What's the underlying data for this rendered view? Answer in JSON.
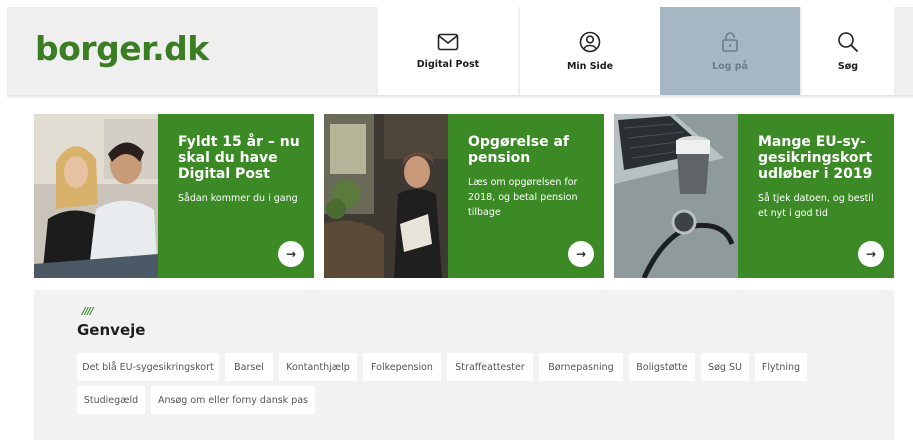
{
  "header": {
    "logo": "borger.dk",
    "nav": [
      {
        "label": "Digital Post",
        "icon": "envelope-icon"
      },
      {
        "label": "Min Side",
        "icon": "user-icon"
      },
      {
        "label": "Log på",
        "icon": "lock-icon"
      },
      {
        "label": "Søg",
        "icon": "search-icon"
      }
    ]
  },
  "cards": [
    {
      "title": "Fyldt 15 år – nu skal du have Digital Post",
      "text": "Sådan kommer du i gang",
      "arrow": "→",
      "image": "two teenagers talking"
    },
    {
      "title": "Opgørelse af pension",
      "text": "Læs om opgørelsen for 2018, og betal pension tilbage",
      "arrow": "→",
      "image": "elderly woman reading"
    },
    {
      "title": "Mange EU-sy-gesikringskort udløber i 2019",
      "text": "Så tjek datoen, og bestil et nyt i god tid",
      "arrow": "→",
      "image": "coffee cup, stethoscope and laptop"
    }
  ],
  "shortcuts": {
    "mark": "////",
    "heading": "Genveje",
    "items": [
      "Det blå EU-sygesikringskort",
      "Barsel",
      "Kontanthjælp",
      "Folkepension",
      "Straffeattester",
      "Børnepasning",
      "Boligstøtte",
      "Søg SU",
      "Flytning",
      "Studiegæld",
      "Ansøg om eller forny dansk pas"
    ]
  },
  "colors": {
    "brand_green": "#3c8a26",
    "login_bg": "#a6b7c4",
    "header_bg": "#efefef"
  }
}
